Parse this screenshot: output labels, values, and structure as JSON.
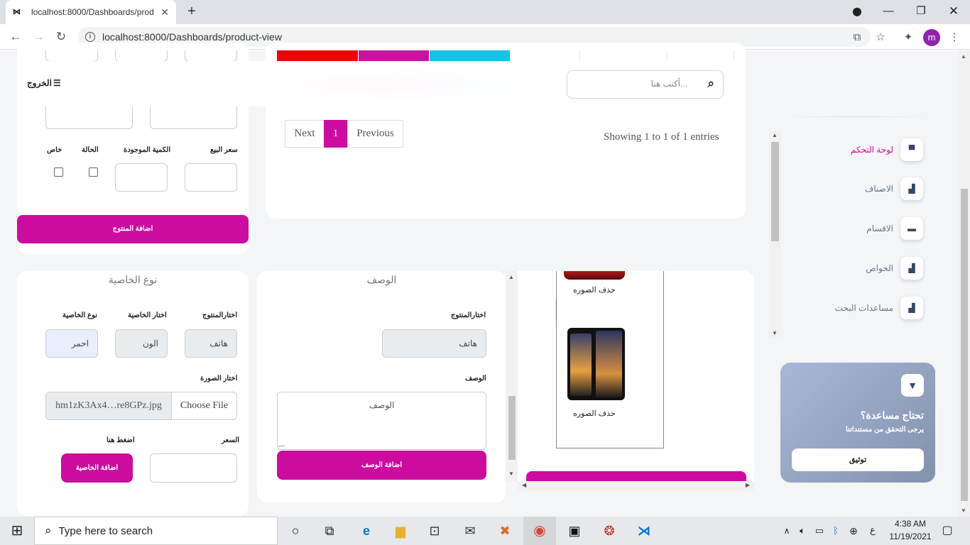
{
  "browser": {
    "tab_title": "localhost:8000/Dashboards/prod",
    "url": "localhost:8000/Dashboards/product-view",
    "profile_initial": "m",
    "accent_profile": "#8e24aa"
  },
  "header": {
    "logout_label": "الخروج",
    "search_placeholder": "أكتب هنا..."
  },
  "sidebar": {
    "items": [
      {
        "label": "لوحة التحكم",
        "icon": "shop-icon",
        "active": true
      },
      {
        "label": "الاصناف",
        "icon": "chart-icon"
      },
      {
        "label": "الاقسام",
        "icon": "card-icon"
      },
      {
        "label": "الخواص",
        "icon": "chart-icon"
      },
      {
        "label": "مساعدات البحث",
        "icon": "chart-icon"
      }
    ],
    "help": {
      "title": "تحتاج مساعدة؟",
      "subtitle": "يرجى التحقق من مستنداتنا",
      "button": "توثيق"
    }
  },
  "table_card": {
    "showing": "Showing 1 to 1 of 1 entries",
    "next": "Next",
    "page": "1",
    "previous": "Previous"
  },
  "product_form": {
    "sale_price_label": "سعر البيع",
    "qty_label": "الكمية الموجودة",
    "status_label": "الحالة",
    "special_label": "خاص",
    "submit": "اضافة المنتوج"
  },
  "attribute_card": {
    "title": "نوع الخاصية",
    "product_label": "اختارالمنتوج",
    "attr_label": "اختار الخاصية",
    "type_label": "نوع الخاصية",
    "product_value": "هاتف",
    "attr_value": "الون",
    "type_value": "احمر",
    "image_label": "اختار الصورة",
    "choose_file": "Choose File",
    "file_name": "hm1zK3Ax4…re8GPz.jpg",
    "price_label": "السعر",
    "press_label": "اضغط هنا",
    "submit": "اضافة الخاصية"
  },
  "description_card": {
    "title": "الوصف",
    "product_label": "اختارالمنتوج",
    "product_value": "هاتف",
    "desc_label": "الوصف",
    "desc_placeholder": "الوصف",
    "submit": "اضافة الوصف"
  },
  "images_card": {
    "delete_label_1": "حذف الصوره",
    "delete_label_2": "حذف الصوره"
  },
  "taskbar": {
    "search_placeholder": "Type here to search",
    "time": "4:38 AM",
    "date": "11/19/2021",
    "lang": "ع"
  },
  "colors": {
    "primary": "#cb0c9f",
    "red_bar": "#ea0606",
    "cyan_bar": "#17c1e8"
  }
}
